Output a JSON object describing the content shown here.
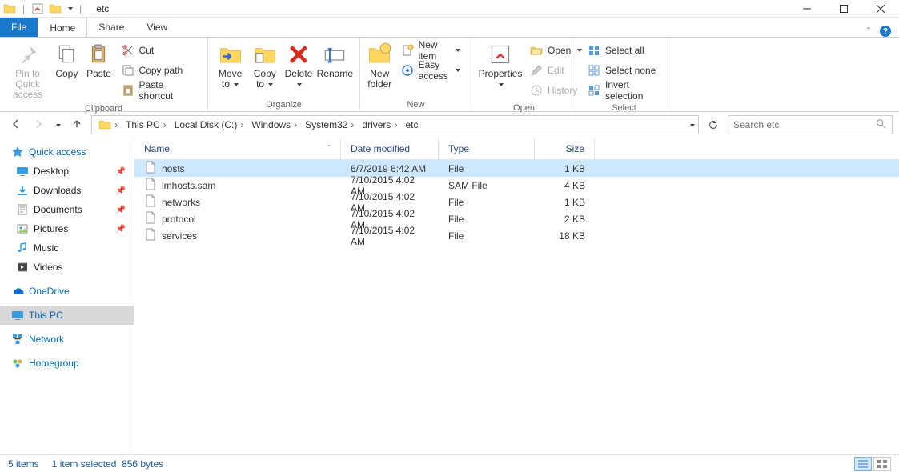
{
  "title": "etc",
  "tabs": {
    "file": "File",
    "home": "Home",
    "share": "Share",
    "view": "View"
  },
  "ribbon": {
    "clipboard": {
      "label": "Clipboard",
      "pin": "Pin to Quick access",
      "copy": "Copy",
      "paste": "Paste",
      "cut": "Cut",
      "copypath": "Copy path",
      "pasteshortcut": "Paste shortcut"
    },
    "organize": {
      "label": "Organize",
      "moveto": "Move to",
      "copyto": "Copy to",
      "delete": "Delete",
      "rename": "Rename"
    },
    "new": {
      "label": "New",
      "newfolder": "New folder",
      "newitem": "New item",
      "easyaccess": "Easy access"
    },
    "open": {
      "label": "Open",
      "properties": "Properties",
      "open": "Open",
      "edit": "Edit",
      "history": "History"
    },
    "select": {
      "label": "Select",
      "selectall": "Select all",
      "selectnone": "Select none",
      "invert": "Invert selection"
    }
  },
  "breadcrumb": [
    "This PC",
    "Local Disk (C:)",
    "Windows",
    "System32",
    "drivers",
    "etc"
  ],
  "search_placeholder": "Search etc",
  "nav": {
    "quickaccess": "Quick access",
    "desktop": "Desktop",
    "downloads": "Downloads",
    "documents": "Documents",
    "pictures": "Pictures",
    "music": "Music",
    "videos": "Videos",
    "onedrive": "OneDrive",
    "thispc": "This PC",
    "network": "Network",
    "homegroup": "Homegroup"
  },
  "columns": {
    "name": "Name",
    "date": "Date modified",
    "type": "Type",
    "size": "Size"
  },
  "files": [
    {
      "name": "hosts",
      "date": "6/7/2019 6:42 AM",
      "type": "File",
      "size": "1 KB",
      "selected": true
    },
    {
      "name": "lmhosts.sam",
      "date": "7/10/2015 4:02 AM",
      "type": "SAM File",
      "size": "4 KB",
      "selected": false
    },
    {
      "name": "networks",
      "date": "7/10/2015 4:02 AM",
      "type": "File",
      "size": "1 KB",
      "selected": false
    },
    {
      "name": "protocol",
      "date": "7/10/2015 4:02 AM",
      "type": "File",
      "size": "2 KB",
      "selected": false
    },
    {
      "name": "services",
      "date": "7/10/2015 4:02 AM",
      "type": "File",
      "size": "18 KB",
      "selected": false
    }
  ],
  "status": {
    "count": "5 items",
    "selected": "1 item selected",
    "size": "856 bytes"
  }
}
